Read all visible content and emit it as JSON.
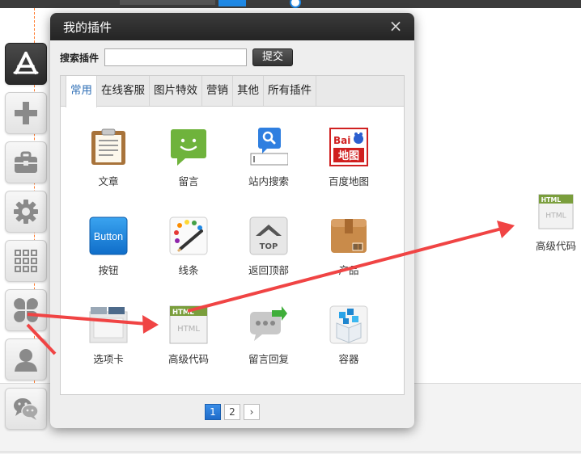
{
  "dialog": {
    "title": "我的插件",
    "close_glyph": "×"
  },
  "search": {
    "label": "搜索插件",
    "value": "",
    "placeholder": "",
    "submit_label": "提交"
  },
  "tabs": [
    {
      "label": "常用",
      "active": true
    },
    {
      "label": "在线客服",
      "active": false
    },
    {
      "label": "图片特效",
      "active": false
    },
    {
      "label": "营销",
      "active": false
    },
    {
      "label": "其他",
      "active": false
    },
    {
      "label": "所有插件",
      "active": false
    }
  ],
  "plugins": [
    {
      "label": "文章",
      "icon": "article-clipboard-icon"
    },
    {
      "label": "留言",
      "icon": "message-bubble-icon"
    },
    {
      "label": "站内搜索",
      "icon": "site-search-icon"
    },
    {
      "label": "百度地图",
      "icon": "baidu-map-icon",
      "icon_text_top": "Bai",
      "icon_text_bottom": "地图"
    },
    {
      "label": "按钮",
      "icon": "button-icon",
      "icon_text": "Button"
    },
    {
      "label": "线条",
      "icon": "lines-palette-icon"
    },
    {
      "label": "返回顶部",
      "icon": "back-to-top-icon",
      "icon_text": "TOP"
    },
    {
      "label": "产品",
      "icon": "product-box-icon"
    },
    {
      "label": "选项卡",
      "icon": "tabs-card-icon"
    },
    {
      "label": "高级代码",
      "icon": "html-code-icon",
      "icon_text_top": "HTML",
      "icon_text_bottom": "HTML"
    },
    {
      "label": "留言回复",
      "icon": "message-reply-icon"
    },
    {
      "label": "容器",
      "icon": "container-box-icon"
    }
  ],
  "pager": {
    "pages": [
      "1",
      "2"
    ],
    "current": "1",
    "next_glyph": "›"
  },
  "dropped_widget": {
    "label": "高级代码",
    "icon": "html-code-icon",
    "icon_text": "HTML"
  },
  "toolbar": [
    {
      "icon": "app-store-icon",
      "active": true
    },
    {
      "icon": "plus-icon",
      "active": false
    },
    {
      "icon": "toolbox-icon",
      "active": false
    },
    {
      "icon": "gear-icon",
      "active": false
    },
    {
      "icon": "grid-dots-icon",
      "active": false
    },
    {
      "icon": "clover-icon",
      "active": false
    },
    {
      "icon": "user-icon",
      "active": false
    },
    {
      "icon": "wechat-icon",
      "active": false
    }
  ],
  "colors": {
    "accent_blue": "#1f6bc9",
    "annotation_red": "#f04444",
    "dialog_header": "#2b2b2b",
    "active_tab_text": "#2f6fb6"
  }
}
